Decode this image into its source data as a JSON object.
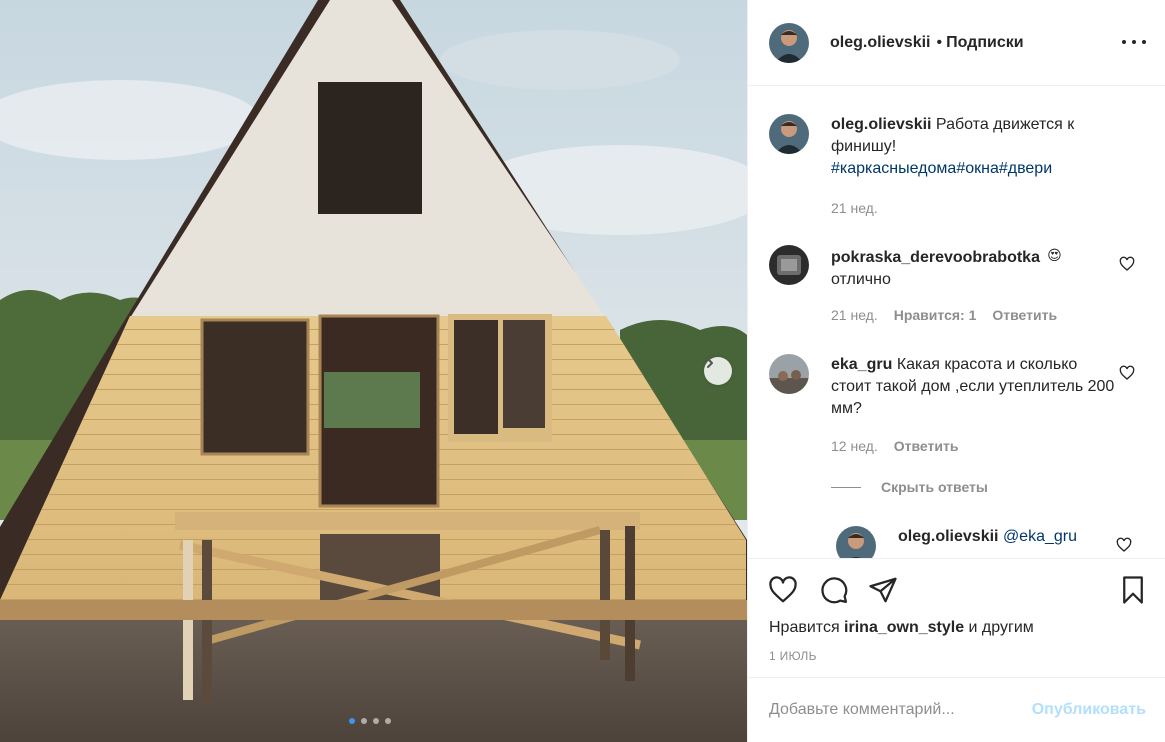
{
  "post": {
    "author": "oleg.olievskii",
    "separator": "•",
    "follow_label": "Подписки",
    "carousel": {
      "slide_count": 4,
      "active_index": 0
    }
  },
  "caption": {
    "username": "oleg.olievskii",
    "text": " Работа движется к финишу!",
    "hashtags": [
      "#каркасныедома",
      "#окна",
      "#двери"
    ],
    "time": "21 нед."
  },
  "comments": [
    {
      "username": "pokraska_derevoobrabotka",
      "emoji": "😍",
      "text": "отлично",
      "time": "21 нед.",
      "likes_label": "Нравится: 1",
      "reply_label": "Ответить"
    },
    {
      "username": "eka_gru",
      "text": " Какая красота и сколько стоит такой дом ,если утеплитель 200 мм?",
      "time": "12 нед.",
      "reply_label": "Ответить"
    }
  ],
  "hide_replies_label": "Скрыть ответы",
  "reply": {
    "username": "oleg.olievskii",
    "mention": "@eka_gru"
  },
  "likes": {
    "prefix": "Нравится ",
    "user": "irina_own_style",
    "suffix": " и другим"
  },
  "date": "1 ИЮЛЬ",
  "comment_box": {
    "placeholder": "Добавьте комментарий...",
    "post_label": "Опубликовать"
  },
  "icons": {
    "like": "heart-icon",
    "comment": "comment-icon",
    "share": "paper-plane-icon",
    "save": "bookmark-icon",
    "more": "more-options-icon",
    "next": "chevron-right-icon"
  },
  "colors": {
    "link": "#00376b",
    "muted": "#8e8e8e",
    "post_button_disabled": "#b2dffc",
    "active_dot": "#3897f0",
    "emoji_face": "#f0b41c",
    "emoji_hearts": "#e0245e"
  }
}
